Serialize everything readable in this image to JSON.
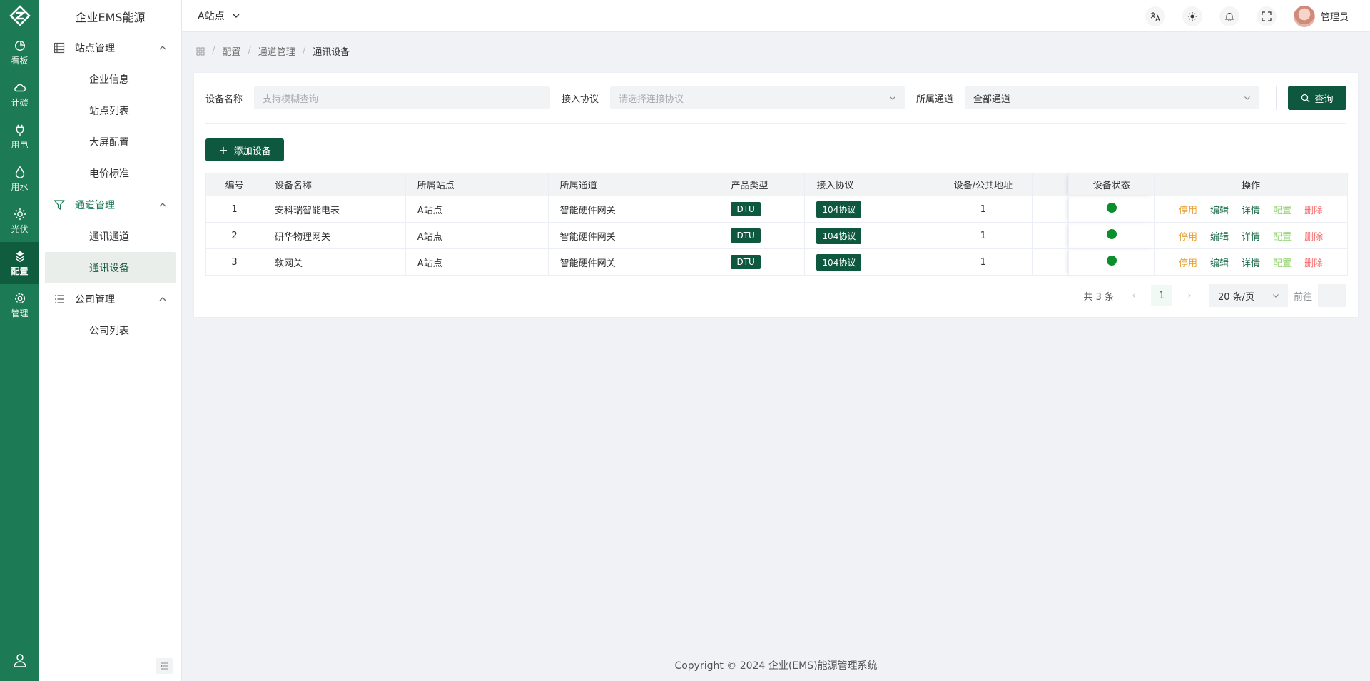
{
  "rail": {
    "items": [
      {
        "label": "看板",
        "icon": "dashboard-icon"
      },
      {
        "label": "计碳",
        "icon": "cloud-icon"
      },
      {
        "label": "用电",
        "icon": "plug-icon"
      },
      {
        "label": "用水",
        "icon": "water-drop-icon"
      },
      {
        "label": "光伏",
        "icon": "sun-icon"
      },
      {
        "label": "配置",
        "icon": "config-icon"
      },
      {
        "label": "管理",
        "icon": "gear-icon"
      }
    ]
  },
  "sidebar": {
    "brand": "企业EMS能源",
    "groups": [
      {
        "label": "站点管理",
        "items": [
          "企业信息",
          "站点列表",
          "大屏配置",
          "电价标准"
        ]
      },
      {
        "label": "通道管理",
        "items": [
          "通讯通道",
          "通讯设备"
        ]
      },
      {
        "label": "公司管理",
        "items": [
          "公司列表"
        ]
      }
    ]
  },
  "header": {
    "station": "A站点",
    "user": "管理员"
  },
  "breadcrumb": [
    "配置",
    "通道管理",
    "通讯设备"
  ],
  "filters": {
    "name_label": "设备名称",
    "name_placeholder": "支持模糊查询",
    "protocol_label": "接入协议",
    "protocol_placeholder": "请选择连接协议",
    "channel_label": "所属通道",
    "channel_value": "全部通道",
    "search_label": "查询"
  },
  "add_button": "添加设备",
  "table": {
    "headers": [
      "编号",
      "设备名称",
      "所属站点",
      "所属通道",
      "产品类型",
      "接入协议",
      "设备/公共地址",
      "",
      "设备状态",
      "操作"
    ],
    "rows": [
      {
        "id": "1",
        "name": "安科瑞智能电表",
        "station": "A站点",
        "channel": "智能硬件网关",
        "type": "DTU",
        "protocol": "104协议",
        "address": "1"
      },
      {
        "id": "2",
        "name": "研华物理网关",
        "station": "A站点",
        "channel": "智能硬件网关",
        "type": "DTU",
        "protocol": "104协议",
        "address": "1"
      },
      {
        "id": "3",
        "name": "软网关",
        "station": "A站点",
        "channel": "智能硬件网关",
        "type": "DTU",
        "protocol": "104协议",
        "address": "1"
      }
    ],
    "actions": {
      "disable": "停用",
      "edit": "编辑",
      "detail": "详情",
      "config": "配置",
      "delete": "删除"
    }
  },
  "pagination": {
    "total": "共 3 条",
    "current": "1",
    "page_size": "20 条/页",
    "goto": "前往"
  },
  "footer": "Copyright © 2024 企业(EMS)能源管理系统",
  "colors": {
    "primary": "#1c7a54",
    "button": "#0f5840",
    "status_ok": "#0a8f2c"
  }
}
